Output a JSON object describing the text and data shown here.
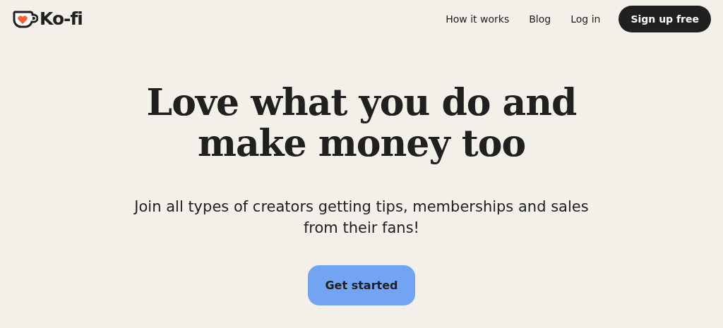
{
  "logo": {
    "text": "Ko-fi"
  },
  "nav": {
    "links": [
      "How it works",
      "Blog",
      "Log in"
    ],
    "cta": "Sign up free"
  },
  "hero": {
    "headline_lines": [
      "Love what you do and",
      "make money too"
    ],
    "subtitle": "Join all types of creators getting tips, memberships and sales from their fans!",
    "button": "Get started"
  }
}
